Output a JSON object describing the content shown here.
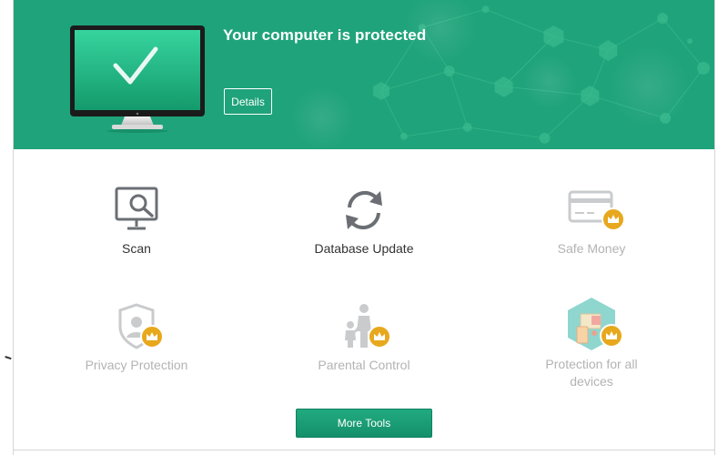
{
  "banner": {
    "status_title": "Your computer is protected",
    "details_label": "Details",
    "color": "#1fa37a"
  },
  "tools": [
    {
      "label": "Scan",
      "icon": "scan-icon",
      "enabled": true
    },
    {
      "label": "Database Update",
      "icon": "update-icon",
      "enabled": true
    },
    {
      "label": "Safe Money",
      "icon": "safe-money-icon",
      "enabled": false,
      "premium": true
    },
    {
      "label": "Privacy Protection",
      "icon": "privacy-icon",
      "enabled": false,
      "premium": true
    },
    {
      "label": "Parental Control",
      "icon": "parental-icon",
      "enabled": false,
      "premium": true
    },
    {
      "label": "Protection for all devices",
      "icon": "devices-icon",
      "enabled": false,
      "premium": true
    }
  ],
  "more_tools_label": "More Tools",
  "colors": {
    "accent": "#1fa37a",
    "premium_crown": "#e7a81d",
    "active_icon": "#6b6f74",
    "disabled_icon": "#c9cbcd"
  }
}
